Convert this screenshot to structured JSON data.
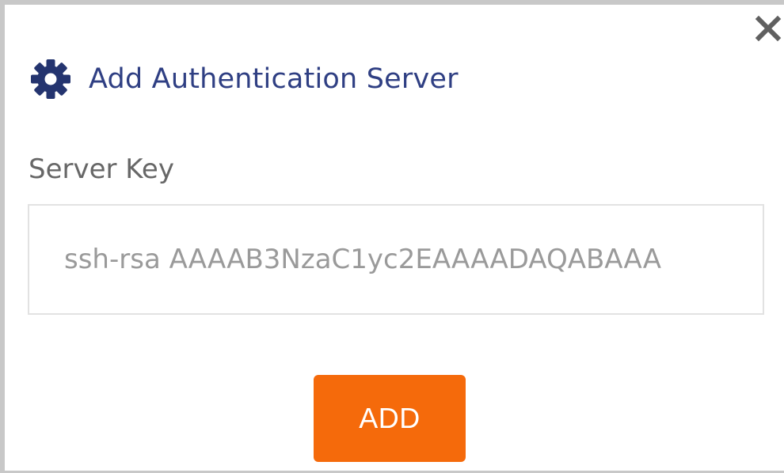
{
  "dialog": {
    "title": "Add Authentication Server",
    "header_icon": "gear-icon",
    "close_icon": "close-icon"
  },
  "form": {
    "server_key_label": "Server Key",
    "server_key_value": "ssh-rsa AAAAB3NzaC1yc2EAAAADAQABAAA"
  },
  "actions": {
    "add_label": "ADD"
  },
  "colors": {
    "accent": "#f56a0b",
    "title": "#2f3f83",
    "icon": "#24346f",
    "border": "#c8c8c8"
  }
}
